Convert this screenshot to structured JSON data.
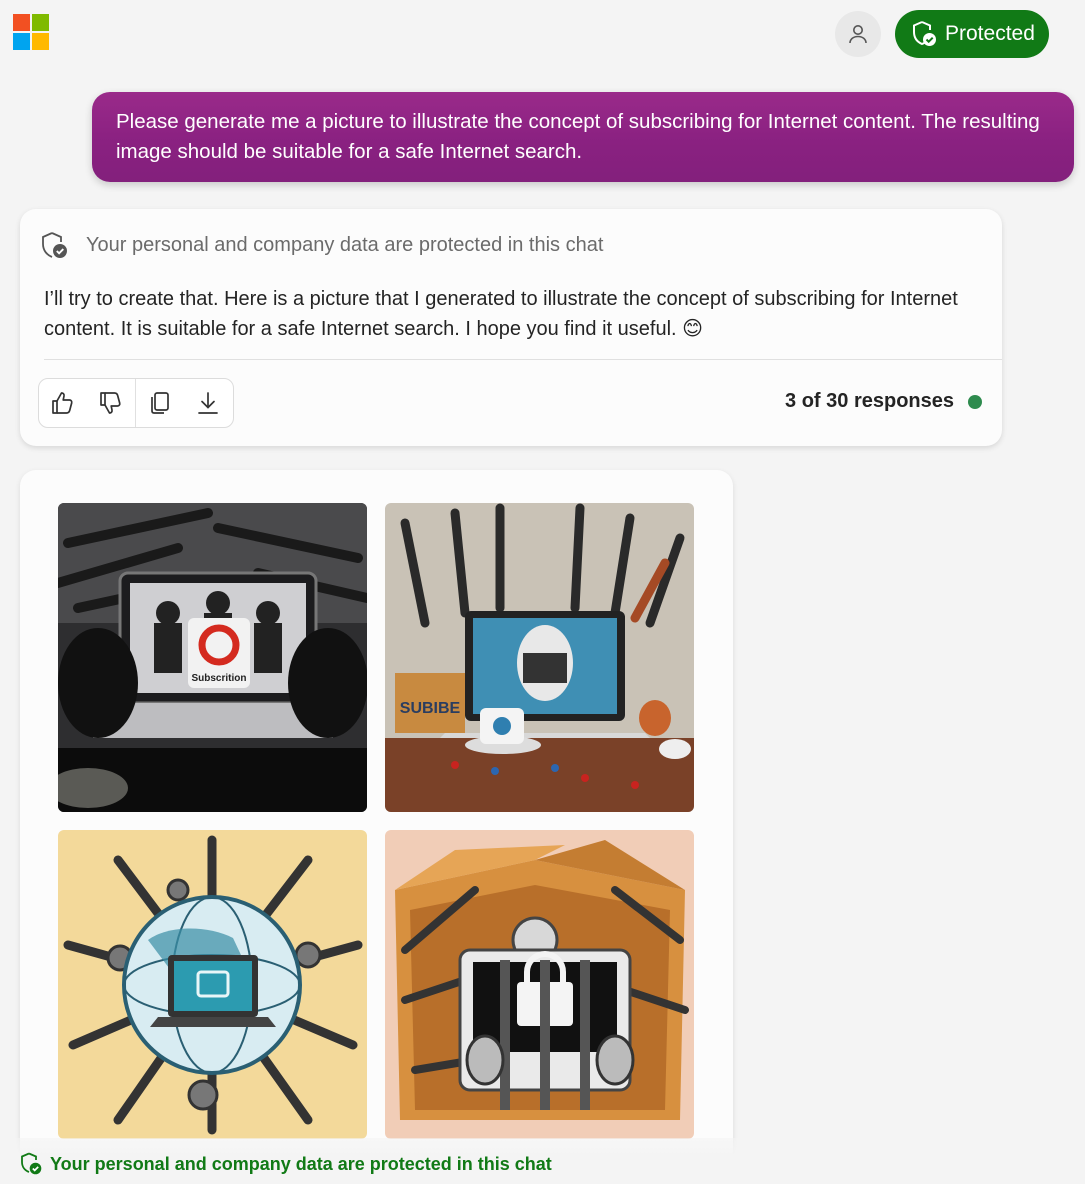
{
  "header": {
    "logo_colors": [
      "#f25022",
      "#7fba00",
      "#00a4ef",
      "#ffb900"
    ],
    "profile_icon": "person-icon",
    "protected_label": "Protected",
    "protected_color": "#117a16"
  },
  "user_message": {
    "text": "Please generate me a picture to illustrate the concept of subscribing for Internet content. The resulting image should be suitable for a safe Internet search."
  },
  "response": {
    "notice": "Your personal and company data are protected in this chat",
    "text": "I’ll try to create that. Here is a picture that I generated to illustrate the concept of subscribing for Internet content. It is suitable for a safe Internet search. I hope you find it useful. 😊",
    "actions": [
      "thumbs-up-icon",
      "thumbs-down-icon",
      "copy-icon",
      "download-icon"
    ],
    "count_label": "3 of 30 responses",
    "status_color": "#2e8b4e"
  },
  "images": {
    "items": [
      {
        "sign_text": "Subscrition"
      },
      {
        "sign_text": "SUBIBE"
      },
      {
        "sign_text": ""
      },
      {
        "sign_text": ""
      }
    ]
  },
  "footer": {
    "notice": "Your personal and company data are protected in this chat"
  }
}
